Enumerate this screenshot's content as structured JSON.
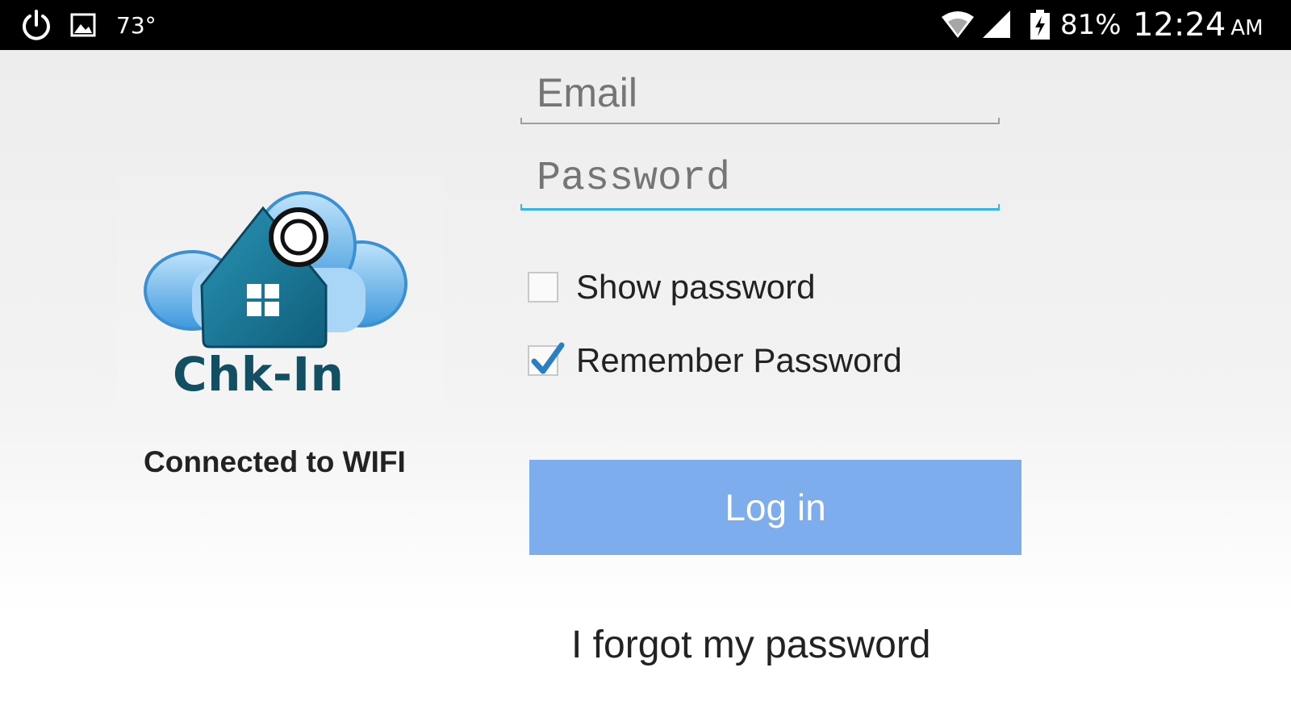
{
  "status_bar": {
    "temperature": "73°",
    "battery": "81%",
    "time": "12:24",
    "ampm": "AM",
    "icons": [
      "power-icon",
      "image-icon",
      "wifi-icon",
      "signal-icon",
      "battery-charging-icon"
    ]
  },
  "logo": {
    "brand": "Chk-In",
    "colors": {
      "house": "#1a7a99",
      "cloud": "#4aa4e0",
      "text": "#124f63"
    }
  },
  "connection_status": "Connected to WIFI",
  "form": {
    "email_placeholder": "Email",
    "email_value": "",
    "password_placeholder": "Password",
    "password_value": "",
    "show_password": {
      "label": "Show password",
      "checked": false
    },
    "remember_password": {
      "label": "Remember Password",
      "checked": true
    },
    "login_label": "Log in",
    "forgot_label": "I forgot my password"
  },
  "colors": {
    "accent": "#33b5e5",
    "button": "#7eadee",
    "checkmark": "#2a7fc2"
  }
}
